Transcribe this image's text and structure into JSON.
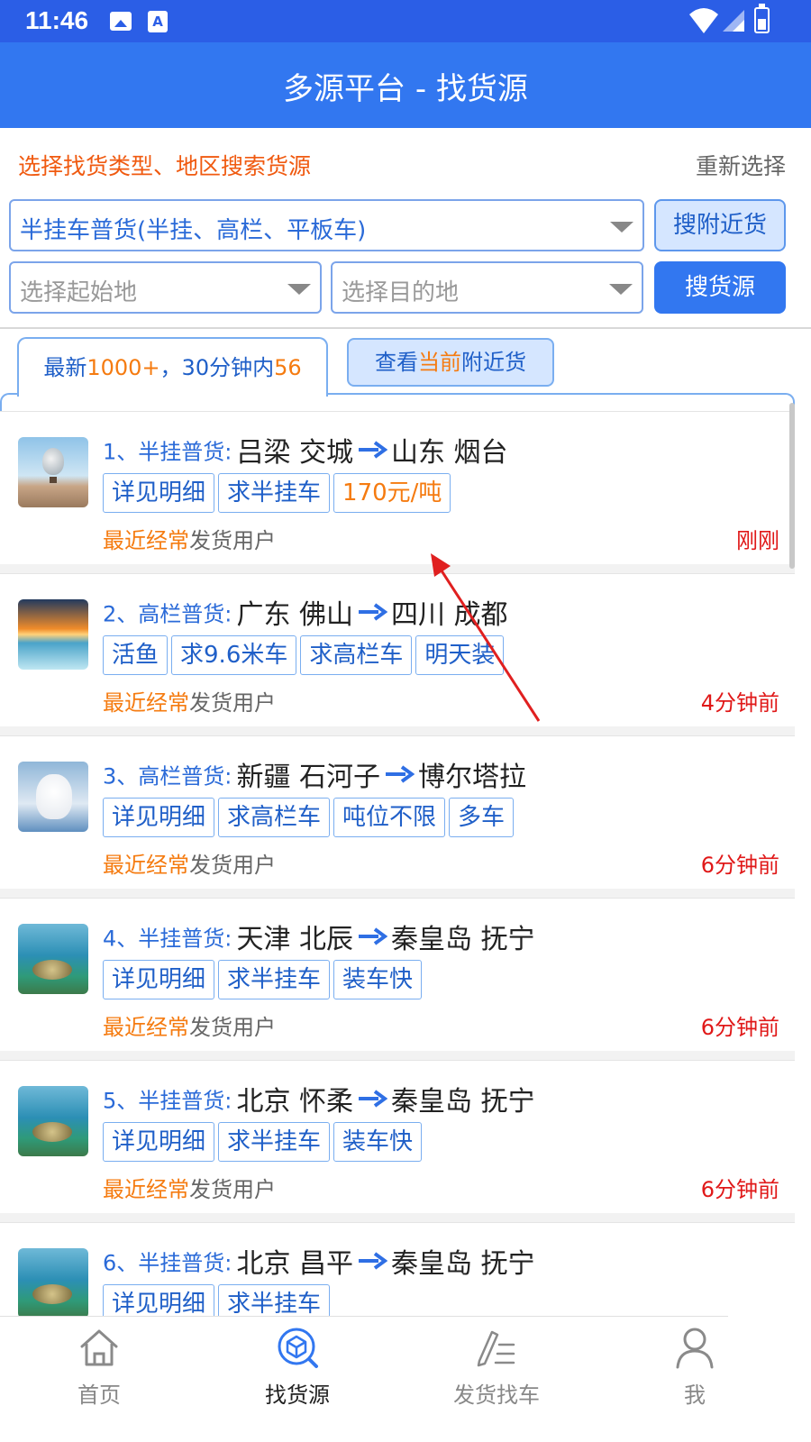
{
  "status_bar": {
    "time": "11:46",
    "notification_icons": [
      "image-icon",
      "a-icon"
    ],
    "system_icons": [
      "wifi-icon",
      "signal-icon",
      "battery-icon"
    ]
  },
  "header": {
    "title": "多源平台 - 找货源",
    "background": "#3277f0"
  },
  "filter": {
    "hint": "选择找货类型、地区搜索货源",
    "reset": "重新选择",
    "type_select": "半挂车普货(半挂、高栏、平板车)",
    "nearby_button": "搜附近货",
    "origin_placeholder": "选择起始地",
    "destination_placeholder": "选择目的地",
    "search_button": "搜货源"
  },
  "tabs": {
    "latest": {
      "prefix": "最新",
      "count": "1000+",
      "middle": "，30分钟内",
      "recent": "56"
    },
    "nearby": {
      "prefix": "查看",
      "highlight": "当前",
      "suffix": "附近货"
    }
  },
  "listings": [
    {
      "index": "1、",
      "category": "半挂普货:",
      "from": "吕梁 交城",
      "to": "山东 烟台",
      "tags": [
        "详见明细",
        "求半挂车"
      ],
      "price": "170元/吨",
      "user_highlight": "最近经常",
      "user_rest": "发货用户",
      "time": "刚刚",
      "thumb": "balloon"
    },
    {
      "index": "2、",
      "category": "高栏普货:",
      "from": "广东 佛山",
      "to": "四川 成都",
      "tags": [
        "活鱼",
        "求9.6米车",
        "求高栏车",
        "明天装"
      ],
      "user_highlight": "最近经常",
      "user_rest": "发货用户",
      "time": "4分钟前",
      "thumb": "sunset"
    },
    {
      "index": "3、",
      "category": "高栏普货:",
      "from": "新疆 石河子",
      "to": "博尔塔拉",
      "tags": [
        "详见明细",
        "求高栏车",
        "吨位不限",
        "多车"
      ],
      "user_highlight": "最近经常",
      "user_rest": "发货用户",
      "time": "6分钟前",
      "thumb": "cat"
    },
    {
      "index": "4、",
      "category": "半挂普货:",
      "from": "天津 北辰",
      "to": "秦皇岛 抚宁",
      "tags": [
        "详见明细",
        "求半挂车",
        "装车快"
      ],
      "user_highlight": "最近经常",
      "user_rest": "发货用户",
      "time": "6分钟前",
      "thumb": "turtle"
    },
    {
      "index": "5、",
      "category": "半挂普货:",
      "from": "北京 怀柔",
      "to": "秦皇岛 抚宁",
      "tags": [
        "详见明细",
        "求半挂车",
        "装车快"
      ],
      "user_highlight": "最近经常",
      "user_rest": "发货用户",
      "time": "6分钟前",
      "thumb": "turtle"
    },
    {
      "index": "6、",
      "category": "半挂普货:",
      "from": "北京 昌平",
      "to": "秦皇岛 抚宁",
      "tags": [
        "详见明细",
        "求半挂车"
      ],
      "thumb": "turtle"
    }
  ],
  "bottom_nav": [
    {
      "label": "首页",
      "icon": "home-icon",
      "active": false
    },
    {
      "label": "找货源",
      "icon": "find-cargo-icon",
      "active": true
    },
    {
      "label": "发货找车",
      "icon": "post-cargo-icon",
      "active": false
    },
    {
      "label": "我",
      "icon": "user-icon",
      "active": false
    }
  ],
  "colors": {
    "accent": "#3277f0",
    "orange": "#f57b10",
    "red_time": "#e01818",
    "tag_blue": "#1f5fc8"
  }
}
